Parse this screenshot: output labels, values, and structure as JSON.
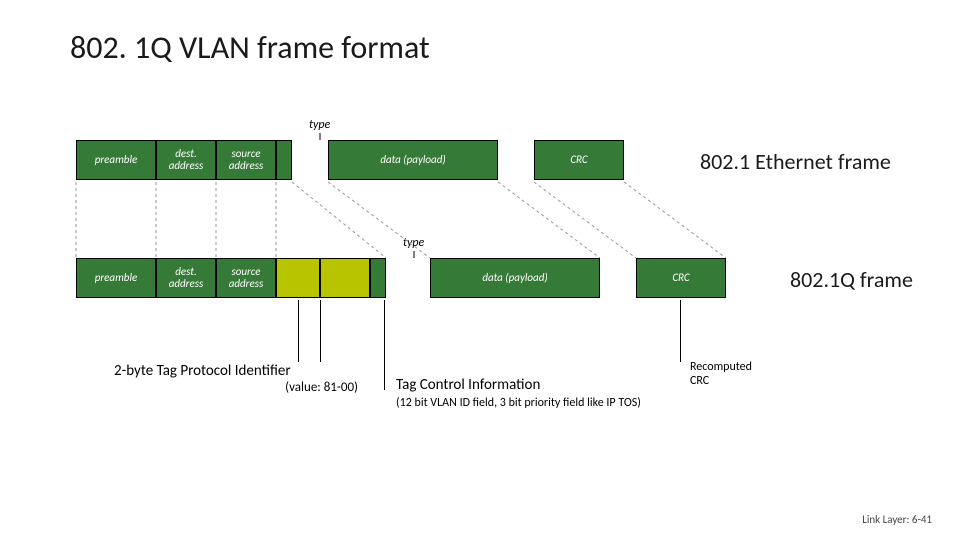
{
  "title": "802. 1Q VLAN frame format",
  "type_label": "type",
  "frame1": {
    "preamble": "preamble",
    "dest": "dest.\naddress",
    "src": "source\naddress",
    "payload": "data (payload)",
    "crc": "CRC",
    "label": "802.1 Ethernet frame"
  },
  "frame2": {
    "preamble": "preamble",
    "dest": "dest.\naddress",
    "src": "source\naddress",
    "payload": "data (payload)",
    "crc": "CRC",
    "label": "802.1Q frame"
  },
  "annot": {
    "tpi_title": "2-byte Tag Protocol Identifier",
    "tpi_value": "(value: 81-00)",
    "tci_title": "Tag Control Information",
    "tci_desc": "(12 bit VLAN ID field, 3 bit priority field like IP TOS)",
    "recomputed": "Recomputed\nCRC"
  },
  "footer": "Link Layer: 6-41"
}
